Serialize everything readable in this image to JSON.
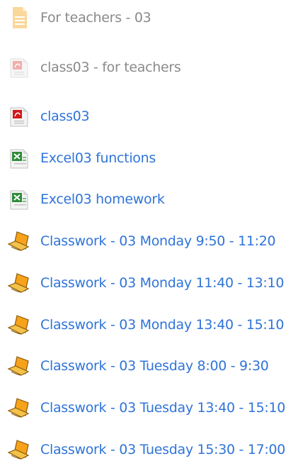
{
  "activities": [
    {
      "label": "For teachers - 03",
      "icon": "page-icon",
      "hidden": true
    },
    {
      "label": "class03 - for teachers",
      "icon": "pdf-file-icon",
      "hidden": true
    },
    {
      "label": "class03",
      "icon": "pdf-file-icon",
      "hidden": false
    },
    {
      "label": "Excel03 functions",
      "icon": "excel-file-icon",
      "hidden": false
    },
    {
      "label": "Excel03 homework",
      "icon": "excel-file-icon",
      "hidden": false
    },
    {
      "label": "Classwork - 03 Monday 9:50 - 11:20",
      "icon": "assignment-icon",
      "hidden": false
    },
    {
      "label": "Classwork - 03 Monday 11:40 - 13:10",
      "icon": "assignment-icon",
      "hidden": false
    },
    {
      "label": "Classwork - 03 Monday 13:40 - 15:10",
      "icon": "assignment-icon",
      "hidden": false
    },
    {
      "label": "Classwork - 03 Tuesday 8:00 - 9:30",
      "icon": "assignment-icon",
      "hidden": false
    },
    {
      "label": "Classwork - 03 Tuesday 13:40 - 15:10",
      "icon": "assignment-icon",
      "hidden": false
    },
    {
      "label": "Classwork - 03 Tuesday 15:30 - 17:00",
      "icon": "assignment-icon",
      "hidden": false
    }
  ],
  "colors": {
    "link": "#2f74d9",
    "hidden_text": "#8a8a8a"
  }
}
